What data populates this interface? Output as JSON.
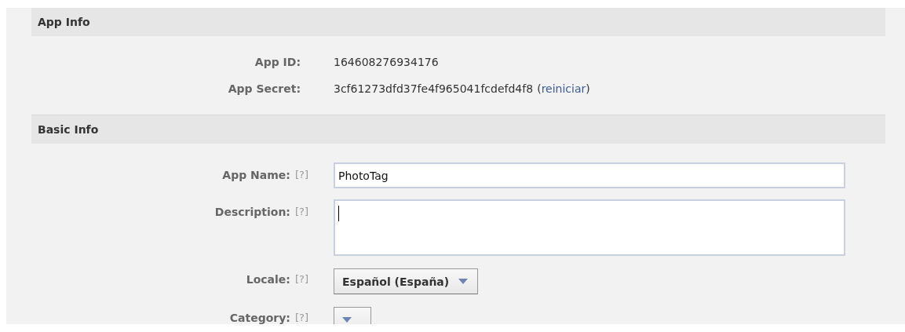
{
  "app_info": {
    "title": "App Info",
    "fields": [
      {
        "label": "App ID:",
        "value": "164608276934176"
      },
      {
        "label": "App Secret:",
        "value": "3cf61273dfd37fe4f965041fcdefd4f8",
        "link_open": "(",
        "link": "reiniciar",
        "link_close": ")"
      }
    ]
  },
  "basic_info": {
    "title": "Basic Info",
    "fields": [
      {
        "kind": "text",
        "label": "App Name:",
        "help": "[?]",
        "value": "PhotoTag",
        "focused": false
      },
      {
        "kind": "textarea",
        "label": "Description:",
        "help": "[?]",
        "focused": true
      },
      {
        "kind": "select",
        "label": "Locale:",
        "help": "[?]",
        "value": "Español (España)"
      },
      {
        "kind": "select",
        "label": "Category:",
        "help": "[?]"
      }
    ]
  }
}
